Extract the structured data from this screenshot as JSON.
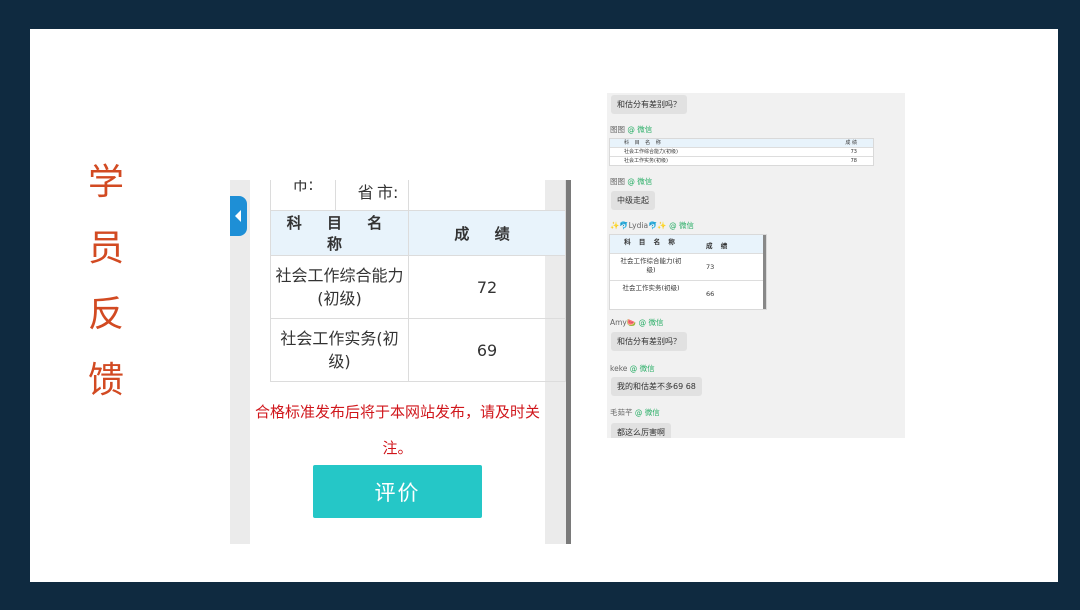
{
  "title_chars": [
    "学",
    "员",
    "反",
    "馈"
  ],
  "score_page": {
    "location": {
      "label_left": "市:",
      "label_province": "省",
      "label_city": "市:"
    },
    "headers": {
      "subject": "科 目 名 称",
      "score": "成 绩"
    },
    "rows": [
      {
        "subject": "社会工作综合能力(初级)",
        "score": "72"
      },
      {
        "subject": "社会工作实务(初级)",
        "score": "69"
      }
    ],
    "notice": "合格标准发布后将于本网站发布，请及时关注。",
    "button_label": "评价"
  },
  "chat": {
    "top_bubble": "和估分有差别吗？",
    "m1": {
      "name": "图图",
      "source": "@ 微信"
    },
    "mini_table_1": {
      "headers": {
        "subject": "科 目 名 称",
        "score": "成 绩"
      },
      "rows": [
        {
          "subject": "社会工作综合能力(初级)",
          "score": "73"
        },
        {
          "subject": "社会工作实务(初级)",
          "score": "78"
        }
      ]
    },
    "m2": {
      "name": "图图",
      "source": "@ 微信",
      "text": "中级走起"
    },
    "m3": {
      "name": "✨🐬Lydia🐬✨",
      "source": "@ 微信"
    },
    "mini_table_2": {
      "headers": {
        "subject": "科 目 名 称",
        "score": "成 绩"
      },
      "rows": [
        {
          "subject": "社会工作综合能力(初级)",
          "score": "73"
        },
        {
          "subject": "社会工作实务(初级)",
          "score": "66"
        }
      ]
    },
    "m4": {
      "name": "Amy🍉",
      "source": "@ 微信",
      "text": "和估分有差别吗？"
    },
    "m5": {
      "name": "keke",
      "source": "@ 微信",
      "text": "我的和估差不多69 68"
    },
    "m6": {
      "name": "毛茹芊",
      "source": "@ 微信",
      "text": "都这么厉害啊"
    }
  }
}
